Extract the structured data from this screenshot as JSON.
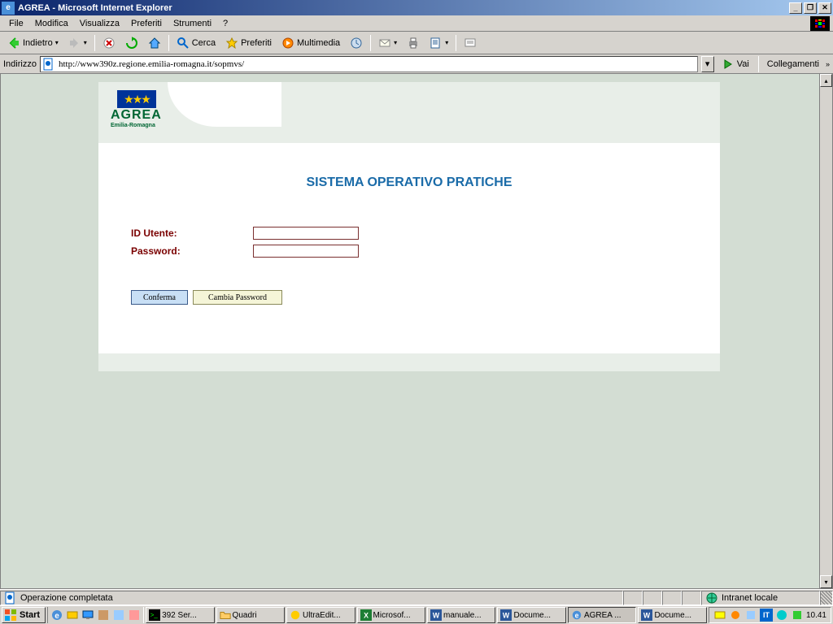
{
  "window": {
    "title": "AGREA - Microsoft Internet Explorer"
  },
  "menu": {
    "file": "File",
    "edit": "Modifica",
    "view": "Visualizza",
    "fav": "Preferiti",
    "tools": "Strumenti",
    "help": "?"
  },
  "toolbar": {
    "back": "Indietro",
    "search": "Cerca",
    "fav": "Preferiti",
    "media": "Multimedia"
  },
  "address": {
    "label": "Indirizzo",
    "url": "http://www390z.regione.emilia-romagna.it/sopmvs/",
    "go": "Vai",
    "links": "Collegamenti"
  },
  "page": {
    "brand": "AGREA",
    "brand_sub": "Emilia-Romagna",
    "title": "SISTEMA OPERATIVO PRATICHE",
    "id_label": "ID Utente:",
    "pw_label": "Password:",
    "confirm": "Conferma",
    "change_pw": "Cambia Password"
  },
  "status": {
    "text": "Operazione completata",
    "zone": "Intranet locale"
  },
  "taskbar": {
    "start": "Start",
    "items": [
      "392 Ser...",
      "Quadri",
      "UltraEdit...",
      "Microsof...",
      "manuale...",
      "Docume...",
      "AGREA ...",
      "Docume..."
    ],
    "clock": "10.41"
  },
  "tray": {
    "lang": "IT"
  }
}
